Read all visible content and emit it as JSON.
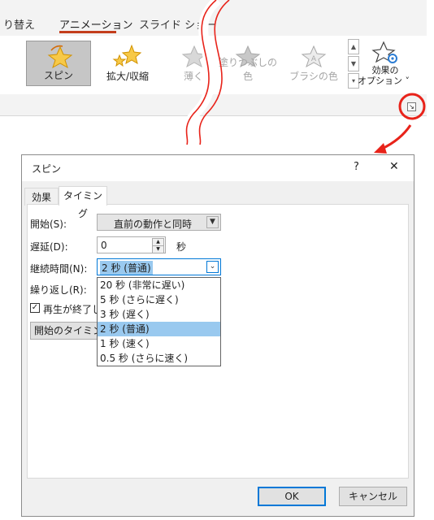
{
  "ribbon": {
    "tabs": [
      "り替え",
      "アニメーション",
      "スライド ショー"
    ],
    "animations": [
      "スピン",
      "拡大/収縮",
      "薄く",
      "塗りつぶしの色",
      "ブラシの色"
    ],
    "effect_options_line1": "効果の",
    "effect_options_line2": "オプション ˅",
    "colors": {
      "accent": "#c43e1c",
      "annotation": "#e8231a",
      "star_gold": "#f4b400"
    }
  },
  "dialog": {
    "title": "スピン",
    "help": "?",
    "close": "✕",
    "tabs": [
      "効果",
      "タイミング"
    ],
    "active_tab": "タイミング",
    "start_label": "開始(S):",
    "start_value": "直前の動作と同時",
    "delay_label": "遅延(D):",
    "delay_value": "0",
    "delay_unit": "秒",
    "duration_label": "継続時間(N):",
    "duration_value": "2 秒 (普通)",
    "repeat_label": "繰り返し(R):",
    "rewind_label": "再生が終了し",
    "rewind_checked": true,
    "triggers_button": "開始のタイミング",
    "duration_options": [
      "20 秒 (非常に遅い)",
      "5 秒 (さらに遅く)",
      "3 秒 (遅く)",
      "2 秒 (普通)",
      "1 秒 (速く)",
      "0.5 秒 (さらに速く)"
    ],
    "selected_option": "2 秒 (普通)",
    "ok": "OK",
    "cancel": "キャンセル"
  }
}
